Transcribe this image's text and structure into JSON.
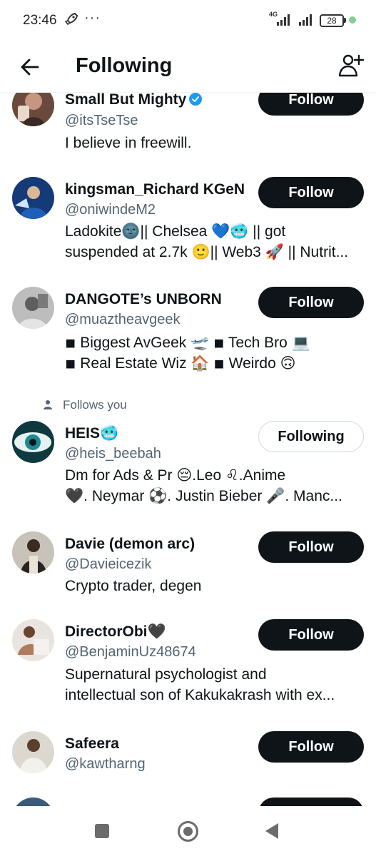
{
  "status_bar": {
    "time": "23:46",
    "dots": "···",
    "network": "4G",
    "battery": "28",
    "icons": [
      "rocket-icon",
      "signal-icon",
      "signal-icon",
      "battery-icon"
    ]
  },
  "header": {
    "title": "Following",
    "back_icon": "arrow-left-icon",
    "add_icon": "add-user-icon"
  },
  "users": [
    {
      "name": "Small But Mighty",
      "verified": true,
      "handle": "@itsTseTse",
      "bio": [
        "I believe in freewill."
      ],
      "button": "Follow",
      "avatar_color": "#a0776a"
    },
    {
      "name": "kingsman_Richard KGeN",
      "handle": "@oniwindeM2",
      "bio": [
        "Ladokite🌚|| Chelsea 💙🥶 || got",
        "suspended at 2.7k 🙂|| Web3 🚀 || Nutrit..."
      ],
      "button": "Follow",
      "avatar_color": "#1c3f7a"
    },
    {
      "name": "DANGOTE’s UNBORN",
      "handle": "@muaztheavgeek",
      "bio": [
        "◾ Biggest AvGeek 🛫 ◾ Tech Bro 💻",
        "◾ Real Estate Wiz 🏠 ◾ Weirdo 🙃"
      ],
      "button": "Follow",
      "avatar_color": "#8d8d8d"
    },
    {
      "follows_you": "Follows you",
      "name": "HEIS🥶",
      "handle": "@heis_beebah",
      "bio": [
        "Dm for Ads & Pr 😔.Leo ♌.Anime",
        "🖤. Neymar ⚽. Justin Bieber 🎤. Manc..."
      ],
      "button": "Following",
      "avatar_color": "#1d6f77"
    },
    {
      "name": "Davie (demon arc)",
      "handle": "@Davieicezik",
      "bio": [
        "Crypto trader, degen"
      ],
      "button": "Follow",
      "avatar_color": "#3a3028"
    },
    {
      "name": "DirectorObi🖤",
      "handle": "@BenjaminUz48674",
      "bio": [
        "Supernatural psychologist and",
        "intellectual son of Kakukakrash with ex..."
      ],
      "button": "Follow",
      "avatar_color": "#b07a5c"
    },
    {
      "name": "Safeera",
      "handle": "@kawtharng",
      "bio": [],
      "button": "Follow",
      "avatar_color": "#d9d4cc"
    }
  ],
  "nav_bar": {
    "icons": [
      "recent-apps-icon",
      "home-icon",
      "back-icon"
    ]
  }
}
